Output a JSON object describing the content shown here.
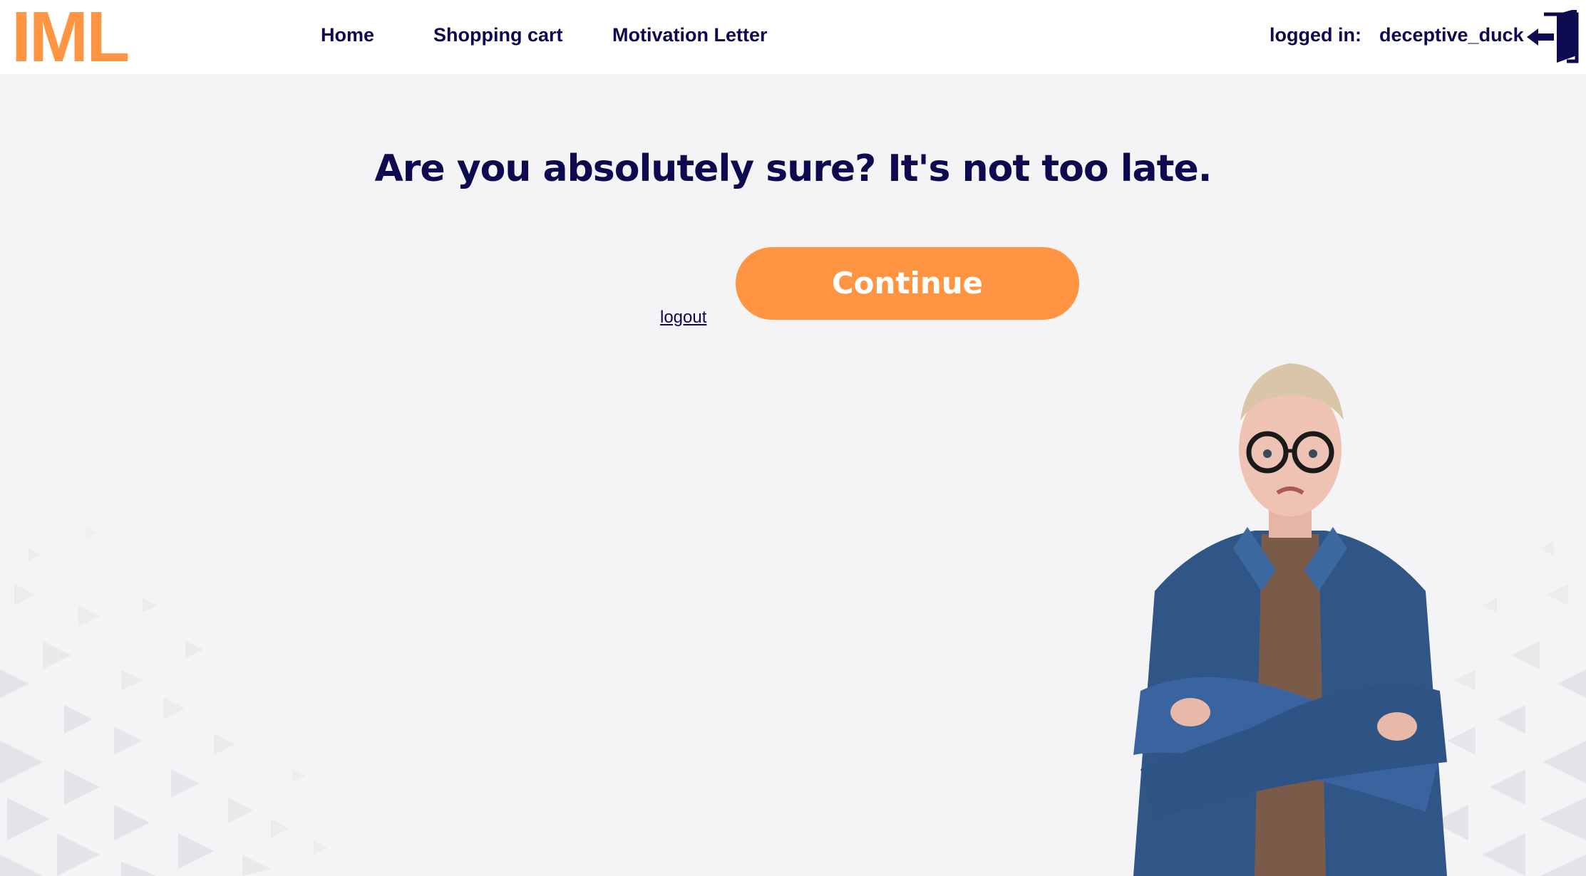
{
  "header": {
    "logo": "IML",
    "nav": [
      {
        "label": "Home"
      },
      {
        "label": "Shopping cart"
      },
      {
        "label": "Motivation Letter"
      }
    ],
    "logged_in_label": "logged in:",
    "username": "deceptive_duck",
    "exit_icon": "exit-door-icon"
  },
  "main": {
    "headline": "Are you absolutely sure? It's not too late.",
    "continue_label": "Continue",
    "logout_label": "logout"
  },
  "colors": {
    "accent": "#ff9542",
    "navy": "#0d0a4f",
    "background": "#f4f4f6",
    "header_bg": "#ffffff"
  }
}
